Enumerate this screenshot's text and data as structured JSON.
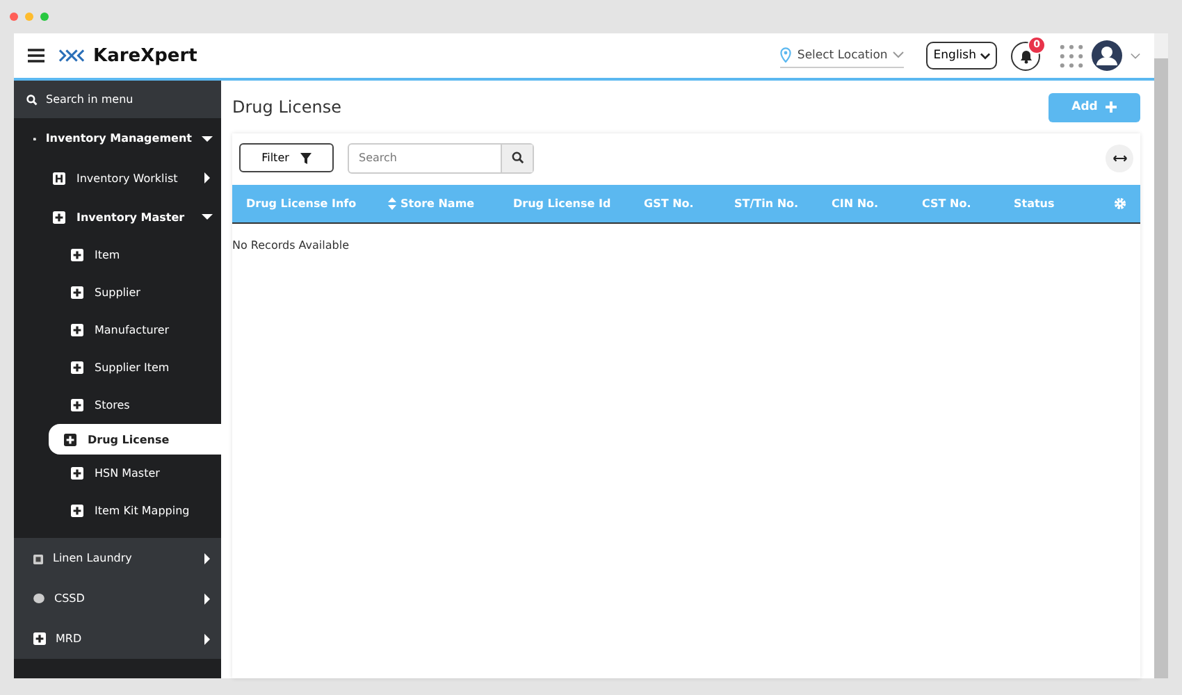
{
  "header": {
    "brand": "KareXpert",
    "location": {
      "placeholder": "Select Location"
    },
    "language": "English",
    "notification_count": "0"
  },
  "sidebar": {
    "search": {
      "placeholder": "Search in menu"
    },
    "items": [
      {
        "label": "Inventory Management",
        "expanded": true,
        "selected": false,
        "children": [
          {
            "label": "Inventory Worklist",
            "expanded": false,
            "selected": false
          },
          {
            "label": "Inventory Master",
            "expanded": true,
            "selected": false,
            "children": [
              {
                "label": "Item",
                "selected": false
              },
              {
                "label": "Supplier",
                "selected": false
              },
              {
                "label": "Manufacturer",
                "selected": false
              },
              {
                "label": "Supplier Item",
                "selected": false
              },
              {
                "label": "Stores",
                "selected": false
              },
              {
                "label": "Drug License",
                "selected": true
              },
              {
                "label": "HSN Master",
                "selected": false
              },
              {
                "label": "Item Kit Mapping",
                "selected": false
              }
            ]
          }
        ]
      },
      {
        "label": "Linen Laundry",
        "expanded": false,
        "selected": false
      },
      {
        "label": "CSSD",
        "expanded": false,
        "selected": false
      },
      {
        "label": "MRD",
        "expanded": false,
        "selected": false
      }
    ]
  },
  "page": {
    "title": "Drug License",
    "add_button": "Add",
    "filter_button": "Filter",
    "search": {
      "placeholder": "Search"
    }
  },
  "table": {
    "columns": [
      {
        "label": "Drug License Info",
        "sortable": false
      },
      {
        "label": "Store Name",
        "sortable": true
      },
      {
        "label": "Drug License Id",
        "sortable": false
      },
      {
        "label": "GST No.",
        "sortable": false
      },
      {
        "label": "ST/Tin No.",
        "sortable": false
      },
      {
        "label": "CIN No.",
        "sortable": false
      },
      {
        "label": "CST No.",
        "sortable": false
      },
      {
        "label": "Status",
        "sortable": false
      }
    ],
    "empty_message": "No Records Available"
  }
}
